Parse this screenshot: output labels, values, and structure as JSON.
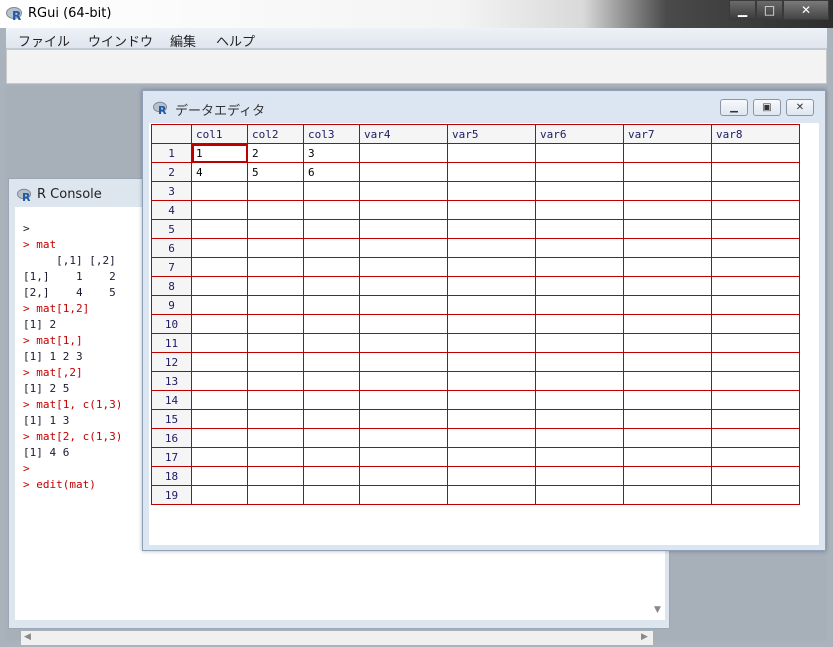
{
  "app": {
    "title": "RGui (64-bit)",
    "icon": "r-logo-icon"
  },
  "window_buttons": {
    "minimize": "▁",
    "maximize": "□",
    "close": "✕"
  },
  "menu": [
    "ファイル",
    "ウインドウ",
    "編集",
    "ヘルプ"
  ],
  "console": {
    "title": "R Console",
    "lines": [
      {
        "text": ">",
        "color": "black"
      },
      {
        "text": "> mat",
        "color": "red"
      },
      {
        "text": "     [,1] [,2]",
        "color": "black"
      },
      {
        "text": "[1,]    1    2",
        "color": "black"
      },
      {
        "text": "[2,]    4    5",
        "color": "black"
      },
      {
        "text": "> mat[1,2]",
        "color": "red"
      },
      {
        "text": "[1] 2",
        "color": "black"
      },
      {
        "text": "> mat[1,]",
        "color": "red"
      },
      {
        "text": "[1] 1 2 3",
        "color": "black"
      },
      {
        "text": "> mat[,2]",
        "color": "red"
      },
      {
        "text": "[1] 2 5",
        "color": "black"
      },
      {
        "text": "> mat[1, c(1,3)",
        "color": "red"
      },
      {
        "text": "[1] 1 3",
        "color": "black"
      },
      {
        "text": "> mat[2, c(1,3)",
        "color": "red"
      },
      {
        "text": "[1] 4 6",
        "color": "black"
      },
      {
        "text": ">",
        "color": "red"
      },
      {
        "text": "> edit(mat)",
        "color": "red"
      }
    ]
  },
  "editor": {
    "title": "データエディタ",
    "columns": [
      "col1",
      "col2",
      "col3",
      "var4",
      "var5",
      "var6",
      "var7",
      "var8"
    ],
    "rows": [
      [
        "1",
        "2",
        "3",
        "",
        "",
        "",
        "",
        ""
      ],
      [
        "4",
        "5",
        "6",
        "",
        "",
        "",
        "",
        ""
      ],
      [
        "",
        "",
        "",
        "",
        "",
        "",
        "",
        ""
      ],
      [
        "",
        "",
        "",
        "",
        "",
        "",
        "",
        ""
      ],
      [
        "",
        "",
        "",
        "",
        "",
        "",
        "",
        ""
      ],
      [
        "",
        "",
        "",
        "",
        "",
        "",
        "",
        ""
      ],
      [
        "",
        "",
        "",
        "",
        "",
        "",
        "",
        ""
      ],
      [
        "",
        "",
        "",
        "",
        "",
        "",
        "",
        ""
      ],
      [
        "",
        "",
        "",
        "",
        "",
        "",
        "",
        ""
      ],
      [
        "",
        "",
        "",
        "",
        "",
        "",
        "",
        ""
      ],
      [
        "",
        "",
        "",
        "",
        "",
        "",
        "",
        ""
      ],
      [
        "",
        "",
        "",
        "",
        "",
        "",
        "",
        ""
      ],
      [
        "",
        "",
        "",
        "",
        "",
        "",
        "",
        ""
      ],
      [
        "",
        "",
        "",
        "",
        "",
        "",
        "",
        ""
      ],
      [
        "",
        "",
        "",
        "",
        "",
        "",
        "",
        ""
      ],
      [
        "",
        "",
        "",
        "",
        "",
        "",
        "",
        ""
      ],
      [
        "",
        "",
        "",
        "",
        "",
        "",
        "",
        ""
      ],
      [
        "",
        "",
        "",
        "",
        "",
        "",
        "",
        ""
      ],
      [
        "",
        "",
        "",
        "",
        "",
        "",
        "",
        ""
      ]
    ],
    "row_numbers": [
      "1",
      "2",
      "3",
      "4",
      "5",
      "6",
      "7",
      "8",
      "9",
      "10",
      "11",
      "12",
      "13",
      "14",
      "15",
      "16",
      "17",
      "18",
      "19"
    ],
    "grid_color": "#c00000"
  }
}
